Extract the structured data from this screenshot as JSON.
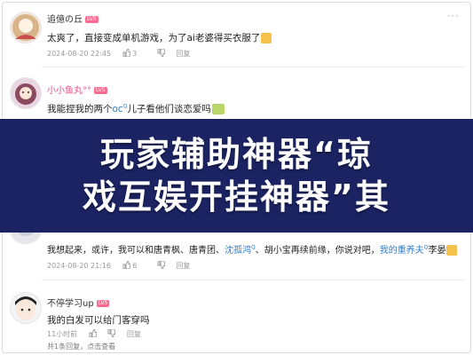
{
  "comments": [
    {
      "username": "追億の丘",
      "level": "LV5",
      "text": "太爽了，直接变成单机游戏，为了ai老婆得买衣服了",
      "time": "2024-08-20 22:45",
      "likes": "3",
      "reply_label": "回复"
    },
    {
      "username": "小小鱼丸°°",
      "level": "LV5",
      "text_before": "我能捏我的两个",
      "highlight": "oc",
      "superscript": "Q",
      "text_after": "儿子看他们谈恋爱吗"
    },
    {
      "username": "",
      "level": "",
      "text_parts": [
        "我想起来，或许，我可以和唐青枫、唐青团、",
        "沈孤鸿",
        "、胡小宝再续前缘，你说对吧，",
        "我的重养夫",
        "李晏"
      ],
      "time": "2024-08-20 21:16",
      "likes": "6",
      "reply_label": "回复"
    },
    {
      "username": "不停学习up",
      "level": "LV5",
      "text": "我的白发可以给门客穿吗",
      "time": "11小时前",
      "reply_label": "回复",
      "replies_summary": "共1条回复，点击查看"
    }
  ],
  "banner": {
    "line1": "玩家辅助神器“琼",
    "line2": "戏互娱开挂神器”其"
  },
  "menu_glyph": "···",
  "icons": [
    "like-icon",
    "dislike-icon",
    "more-icon"
  ]
}
